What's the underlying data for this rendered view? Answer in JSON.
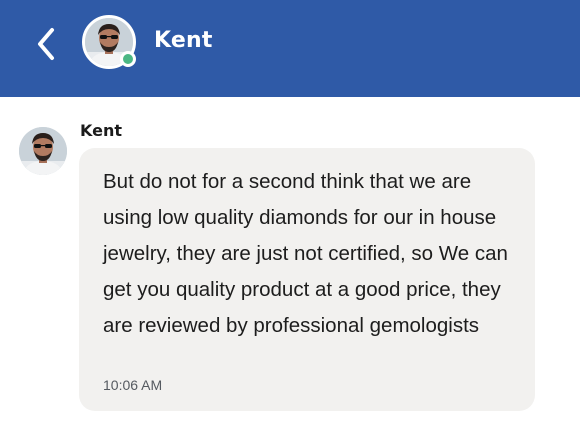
{
  "header": {
    "contact_name": "Kent",
    "back_icon": "chevron-left-icon",
    "presence_status": "online",
    "presence_color": "#4bb784",
    "background_color": "#2f5aa7"
  },
  "messages": [
    {
      "sender": "Kent",
      "text": "But do not for a second think that we are using low quality diamonds for our in house jewelry, they are just not certified, so We can get you quality product at a good price, they are reviewed by professional gemologists",
      "time": "10:06 AM"
    }
  ]
}
